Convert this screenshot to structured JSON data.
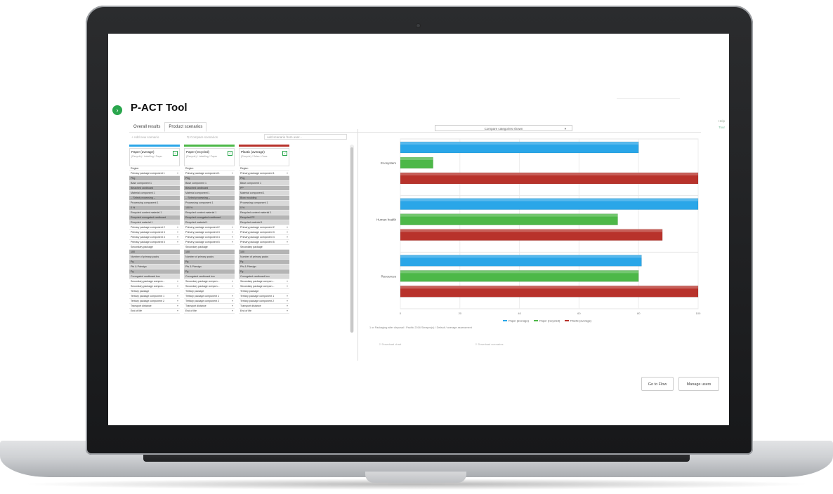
{
  "app": {
    "title": "P-ACT Tool",
    "badge": "›"
  },
  "tabs": [
    {
      "label": "Overall results",
      "active": false
    },
    {
      "label": "Product scenarios",
      "active": true
    }
  ],
  "help": {
    "help_label": "Help",
    "tour_label": "Tour"
  },
  "toolbar": {
    "add_label": "Add new scenario",
    "compare_label": "Compare scenarios",
    "load_placeholder": "Add scenario from user..."
  },
  "scenarios": [
    {
      "name": "Paper (average)",
      "sub": "(Recycle) / Labelling / Paper",
      "color": "#2aa6e8",
      "rows": [
        {
          "t": "Region",
          "k": "plain"
        },
        {
          "t": "Primary package component 1",
          "k": "n"
        },
        {
          "t": "Pbg",
          "k": "dark"
        },
        {
          "t": "Base component 1",
          "k": "light"
        },
        {
          "t": "Bleached cardboard",
          "k": "dark"
        },
        {
          "t": "Material component 1",
          "k": "light"
        },
        {
          "t": "-- Select processing --",
          "k": "dark"
        },
        {
          "t": "Processing component 1",
          "k": "light"
        },
        {
          "t": "0 %",
          "k": "dark"
        },
        {
          "t": "Recycled content material 1",
          "k": "light"
        },
        {
          "t": "Recycled corrugated cardboard",
          "k": "dark"
        },
        {
          "t": "Recycled material 1",
          "k": "light"
        },
        {
          "t": "Primary package component 2",
          "k": "n"
        },
        {
          "t": "Primary package component 3",
          "k": "n"
        },
        {
          "t": "Primary package component 4",
          "k": "n"
        },
        {
          "t": "Primary package component 5",
          "k": "n"
        },
        {
          "t": "Secondary package",
          "k": "plain"
        },
        {
          "t": "100",
          "k": "dark"
        },
        {
          "t": "Number of primary packs",
          "k": "light"
        },
        {
          "t": "Pg",
          "k": "dark"
        },
        {
          "t": "Pfs & Pdesign",
          "k": "light"
        },
        {
          "t": "Pg",
          "k": "dark"
        },
        {
          "t": "Corrugated cardboard box",
          "k": "light"
        },
        {
          "t": "Secondary package compon...",
          "k": "n"
        },
        {
          "t": "Secondary package compon...",
          "k": "n"
        },
        {
          "t": "Tertiary package",
          "k": "plain"
        },
        {
          "t": "Tertiary package component 1",
          "k": "n"
        },
        {
          "t": "Tertiary package component 2",
          "k": "n"
        },
        {
          "t": "Transport distance",
          "k": "n"
        },
        {
          "t": "End of life",
          "k": "n"
        }
      ]
    },
    {
      "name": "Paper (recycled)",
      "sub": "(Recycle) / Labelling / Paper",
      "color": "#4db848",
      "rows": [
        {
          "t": "Region",
          "k": "plain"
        },
        {
          "t": "Primary package component 1",
          "k": "n"
        },
        {
          "t": "Pbg",
          "k": "dark"
        },
        {
          "t": "Base component 1",
          "k": "light"
        },
        {
          "t": "Bleached cardboard",
          "k": "dark"
        },
        {
          "t": "Material component 1",
          "k": "light"
        },
        {
          "t": "-- Select processing --",
          "k": "dark"
        },
        {
          "t": "Processing component 1",
          "k": "light"
        },
        {
          "t": "100 %",
          "k": "dark"
        },
        {
          "t": "Recycled content material 1",
          "k": "light"
        },
        {
          "t": "Recycled corrugated cardboard",
          "k": "dark"
        },
        {
          "t": "Recycled material 1",
          "k": "light"
        },
        {
          "t": "Primary package component 2",
          "k": "n"
        },
        {
          "t": "Primary package component 3",
          "k": "n"
        },
        {
          "t": "Primary package component 4",
          "k": "n"
        },
        {
          "t": "Primary package component 5",
          "k": "n"
        },
        {
          "t": "Secondary package",
          "k": "plain"
        },
        {
          "t": "100",
          "k": "dark"
        },
        {
          "t": "Number of primary packs",
          "k": "light"
        },
        {
          "t": "Pg",
          "k": "dark"
        },
        {
          "t": "Pfs & Pdesign",
          "k": "light"
        },
        {
          "t": "Pg",
          "k": "dark"
        },
        {
          "t": "Corrugated cardboard box",
          "k": "light"
        },
        {
          "t": "Secondary package compon...",
          "k": "n"
        },
        {
          "t": "Secondary package compon...",
          "k": "n"
        },
        {
          "t": "Tertiary package",
          "k": "plain"
        },
        {
          "t": "Tertiary package component 1",
          "k": "n"
        },
        {
          "t": "Tertiary package component 2",
          "k": "n"
        },
        {
          "t": "Transport distance",
          "k": "n"
        },
        {
          "t": "End of life",
          "k": "n"
        }
      ]
    },
    {
      "name": "Plastic (average)",
      "sub": "(Recycle) / Sales / Case",
      "color": "#b8322b",
      "rows": [
        {
          "t": "Region",
          "k": "plain"
        },
        {
          "t": "Primary package component 1",
          "k": "n"
        },
        {
          "t": "Pbg",
          "k": "dark"
        },
        {
          "t": "Base component 1",
          "k": "light"
        },
        {
          "t": "PP",
          "k": "dark"
        },
        {
          "t": "Material component 1",
          "k": "light"
        },
        {
          "t": "Blow moulding",
          "k": "dark"
        },
        {
          "t": "Processing component 1",
          "k": "light"
        },
        {
          "t": "0 %",
          "k": "dark"
        },
        {
          "t": "Recycled content material 1",
          "k": "light"
        },
        {
          "t": "Recycled PP",
          "k": "dark"
        },
        {
          "t": "Recycled material 1",
          "k": "light"
        },
        {
          "t": "Primary package component 2",
          "k": "n"
        },
        {
          "t": "Primary package component 3",
          "k": "n"
        },
        {
          "t": "Primary package component 4",
          "k": "n"
        },
        {
          "t": "Primary package component 5",
          "k": "n"
        },
        {
          "t": "Secondary package",
          "k": "plain"
        },
        {
          "t": "100",
          "k": "dark"
        },
        {
          "t": "Number of primary packs",
          "k": "light"
        },
        {
          "t": "Pg",
          "k": "dark"
        },
        {
          "t": "Pfs & Pdesign",
          "k": "light"
        },
        {
          "t": "Pg",
          "k": "dark"
        },
        {
          "t": "Corrugated cardboard box",
          "k": "light"
        },
        {
          "t": "Secondary package compon...",
          "k": "n"
        },
        {
          "t": "Secondary package compon...",
          "k": "n"
        },
        {
          "t": "Tertiary package",
          "k": "plain"
        },
        {
          "t": "Tertiary package component 1",
          "k": "n"
        },
        {
          "t": "Tertiary package component 2",
          "k": "n"
        },
        {
          "t": "Transport distance",
          "k": "n"
        },
        {
          "t": "End of life",
          "k": "n"
        }
      ]
    }
  ],
  "compare_select": {
    "value": "Compare categories shown"
  },
  "chart_data": {
    "type": "bar",
    "orientation": "horizontal",
    "categories": [
      "Ecosystem",
      "Human health",
      "Resources"
    ],
    "series": [
      {
        "name": "Paper (average)",
        "color": "#2aa6e8",
        "values": [
          80,
          100,
          81
        ]
      },
      {
        "name": "Paper (recycled)",
        "color": "#4db848",
        "values": [
          11,
          73,
          80
        ]
      },
      {
        "name": "Plastic (average)",
        "color": "#b8322b",
        "values": [
          100,
          88,
          100
        ]
      }
    ],
    "xlim": [
      0,
      100
    ],
    "x_ticks": [
      "0",
      "20",
      "40",
      "60",
      "80",
      "100"
    ],
    "grid": true,
    "legend_position": "bottom"
  },
  "footnote": "1 or Packaging after disposal / Pacific 2016 Simapro(s) / Default / average assessment",
  "chart_actions": {
    "download_chart": "Download chart",
    "download_scenarios": "Download scenarios"
  },
  "buttons": {
    "go_to_flow": "Go to Flow",
    "manage_users": "Manage users"
  }
}
